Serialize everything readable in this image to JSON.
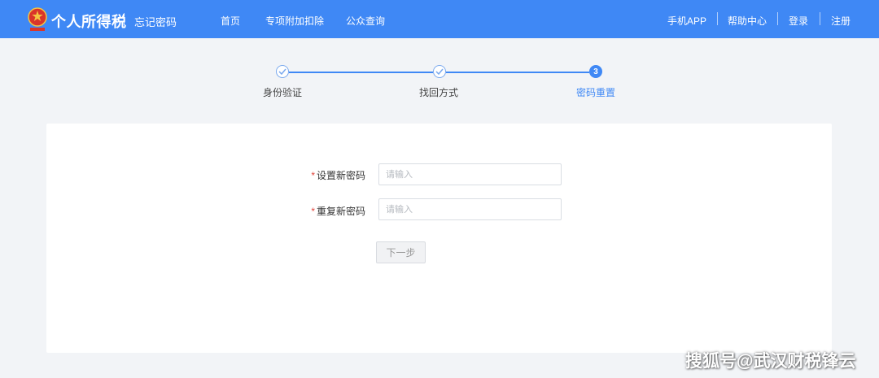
{
  "header": {
    "brand": "个人所得税",
    "subtitle": "忘记密码",
    "nav": [
      "首页",
      "专项附加扣除",
      "公众查询"
    ],
    "right_links": [
      "手机APP",
      "帮助中心",
      "登录",
      "注册"
    ],
    "logo_icon": "tax-emblem-icon",
    "bg_color": "#3f88f5"
  },
  "steps": [
    {
      "label": "身份验证",
      "state": "done",
      "icon": "check-icon"
    },
    {
      "label": "找回方式",
      "state": "done",
      "icon": "check-icon"
    },
    {
      "label": "密码重置",
      "state": "active",
      "number": "3"
    }
  ],
  "form": {
    "new_password": {
      "required_mark": "*",
      "label": "设置新密码",
      "placeholder": "请输入",
      "value": ""
    },
    "repeat_password": {
      "required_mark": "*",
      "label": "重复新密码",
      "placeholder": "请输入",
      "value": ""
    },
    "next_button": "下一步"
  },
  "watermark": "搜狐号@武汉财税锋云"
}
